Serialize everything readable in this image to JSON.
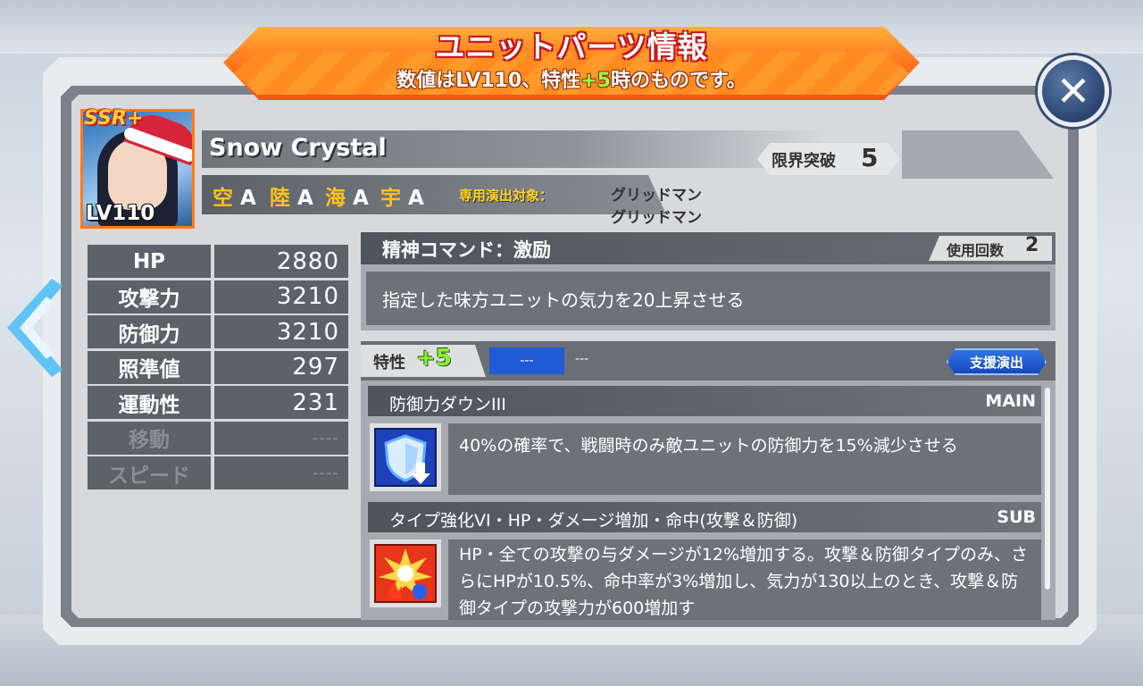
{
  "header": {
    "title": "ユニットパーツ情報",
    "subtitle_prefix": "数値はLV110、特性",
    "subtitle_highlight": "+5",
    "subtitle_suffix": "時のものです。"
  },
  "unit": {
    "rarity": "SSR+",
    "level": "LV110",
    "name": "Snow Crystal",
    "limit_break_label": "限界突破",
    "limit_break_value": "5",
    "terrain": [
      {
        "name": "空",
        "grade": "A"
      },
      {
        "name": "陸",
        "grade": "A"
      },
      {
        "name": "海",
        "grade": "A"
      },
      {
        "name": "宇",
        "grade": "A"
      }
    ],
    "special_label": "専用演出対象：",
    "special_targets": [
      "グリッドマン",
      "グリッドマン"
    ]
  },
  "stats": [
    {
      "label": "HP",
      "value": "2880"
    },
    {
      "label": "攻撃力",
      "value": "3210"
    },
    {
      "label": "防御力",
      "value": "3210"
    },
    {
      "label": "照準値",
      "value": "297"
    },
    {
      "label": "運動性",
      "value": "231"
    },
    {
      "label": "移動",
      "value": "----"
    },
    {
      "label": "スピード",
      "value": "----"
    }
  ],
  "spirit_command": {
    "title": "精神コマンド：激励",
    "uses_label": "使用回数",
    "uses_value": "2",
    "description": "指定した味方ユニットの気力を20上昇させる"
  },
  "trait": {
    "label": "特性",
    "level": "+5",
    "slot_value": "---",
    "slot_text": "---",
    "support_button": "支援演出",
    "skills": [
      {
        "name": "防御力ダウンIII",
        "type": "MAIN",
        "icon": "shield-down-icon",
        "description": "40%の確率で、戦闘時のみ敵ユニットの防御力を15%減少させる"
      },
      {
        "name": "タイプ強化VI・HP・ダメージ増加・命中(攻撃＆防御)",
        "type": "SUB",
        "icon": "burst-icon",
        "description": "HP・全ての攻撃の与ダメージが12%増加する。攻撃＆防御タイプのみ、さらにHPが10.5%、命中率が3%増加し、気力が130以上のとき、攻撃＆防御タイプの攻撃力が600増加す"
      }
    ]
  },
  "colors": {
    "banner": "#ff7a1f",
    "terrain_letter": "#ffc21a",
    "highlight_green": "#8bf03a",
    "support_blue": "#1f5bd4"
  }
}
